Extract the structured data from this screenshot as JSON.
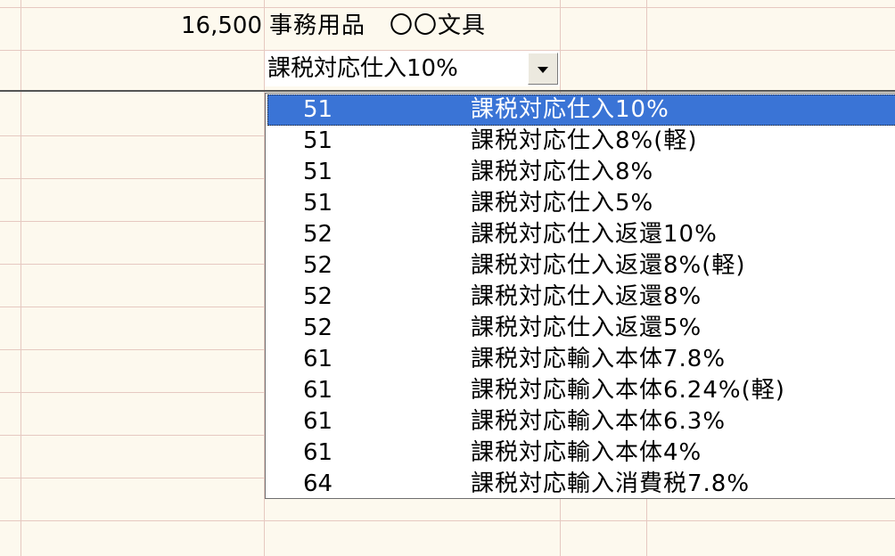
{
  "row1": {
    "amount": "16,500",
    "description": "事務用品　〇〇文具"
  },
  "tax_combo": {
    "value": "課税対応仕入10%",
    "button_icon": "chevron-down-icon"
  },
  "dropdown": {
    "selected_index": 0,
    "selected_color": "#3a74d6",
    "options": [
      {
        "code": "51",
        "label": "課税対応仕入10%"
      },
      {
        "code": "51",
        "label": "課税対応仕入8%(軽)"
      },
      {
        "code": "51",
        "label": "課税対応仕入8%"
      },
      {
        "code": "51",
        "label": "課税対応仕入5%"
      },
      {
        "code": "52",
        "label": "課税対応仕入返還10%"
      },
      {
        "code": "52",
        "label": "課税対応仕入返還8%(軽)"
      },
      {
        "code": "52",
        "label": "課税対応仕入返還8%"
      },
      {
        "code": "52",
        "label": "課税対応仕入返還5%"
      },
      {
        "code": "61",
        "label": "課税対応輸入本体7.8%"
      },
      {
        "code": "61",
        "label": "課税対応輸入本体6.24%(軽)"
      },
      {
        "code": "61",
        "label": "課税対応輸入本体6.3%"
      },
      {
        "code": "61",
        "label": "課税対応輸入本体4%"
      },
      {
        "code": "64",
        "label": "課税対応輸入消費税7.8%"
      }
    ]
  }
}
